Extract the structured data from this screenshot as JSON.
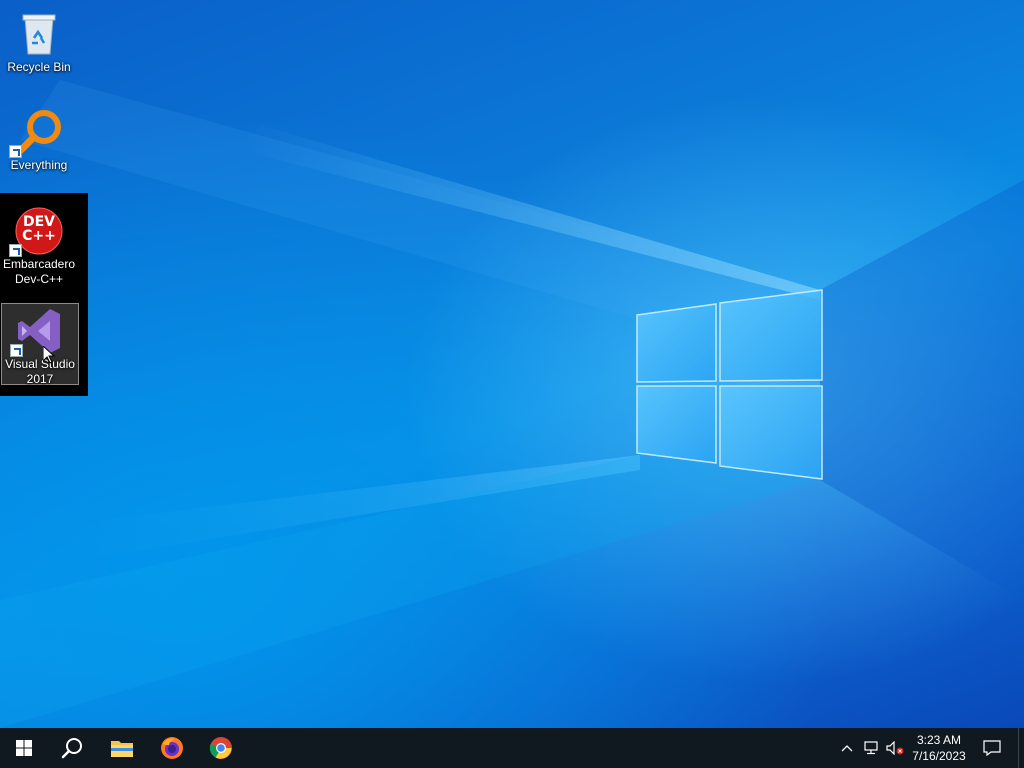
{
  "desktop": {
    "icons": [
      {
        "label": "Recycle Bin",
        "icon": "recycle-bin-icon"
      },
      {
        "label": "Everything",
        "icon": "everything-search-icon"
      },
      {
        "label": "Embarcadero Dev-C++",
        "icon": "devcpp-icon",
        "logo_text": "DEV C++"
      },
      {
        "label": "Visual Studio 2017",
        "icon": "visual-studio-icon"
      }
    ]
  },
  "taskbar": {
    "pinned": [
      {
        "name": "start",
        "icon": "windows-start-icon"
      },
      {
        "name": "search",
        "icon": "search-icon"
      },
      {
        "name": "file-explorer",
        "icon": "folder-icon"
      },
      {
        "name": "firefox",
        "icon": "firefox-icon"
      },
      {
        "name": "chrome",
        "icon": "chrome-icon"
      }
    ],
    "tray": {
      "icons": [
        "chevron-up-icon",
        "network-icon",
        "volume-muted-icon",
        "notifications-icon"
      ]
    },
    "clock": {
      "time": "3:23 AM",
      "date": "7/16/2023"
    }
  },
  "colors": {
    "taskbar": "#101820",
    "wallpaper_blue": "#0a7ad8",
    "devcpp_red": "#d01818",
    "vs_purple": "#865fc5"
  }
}
